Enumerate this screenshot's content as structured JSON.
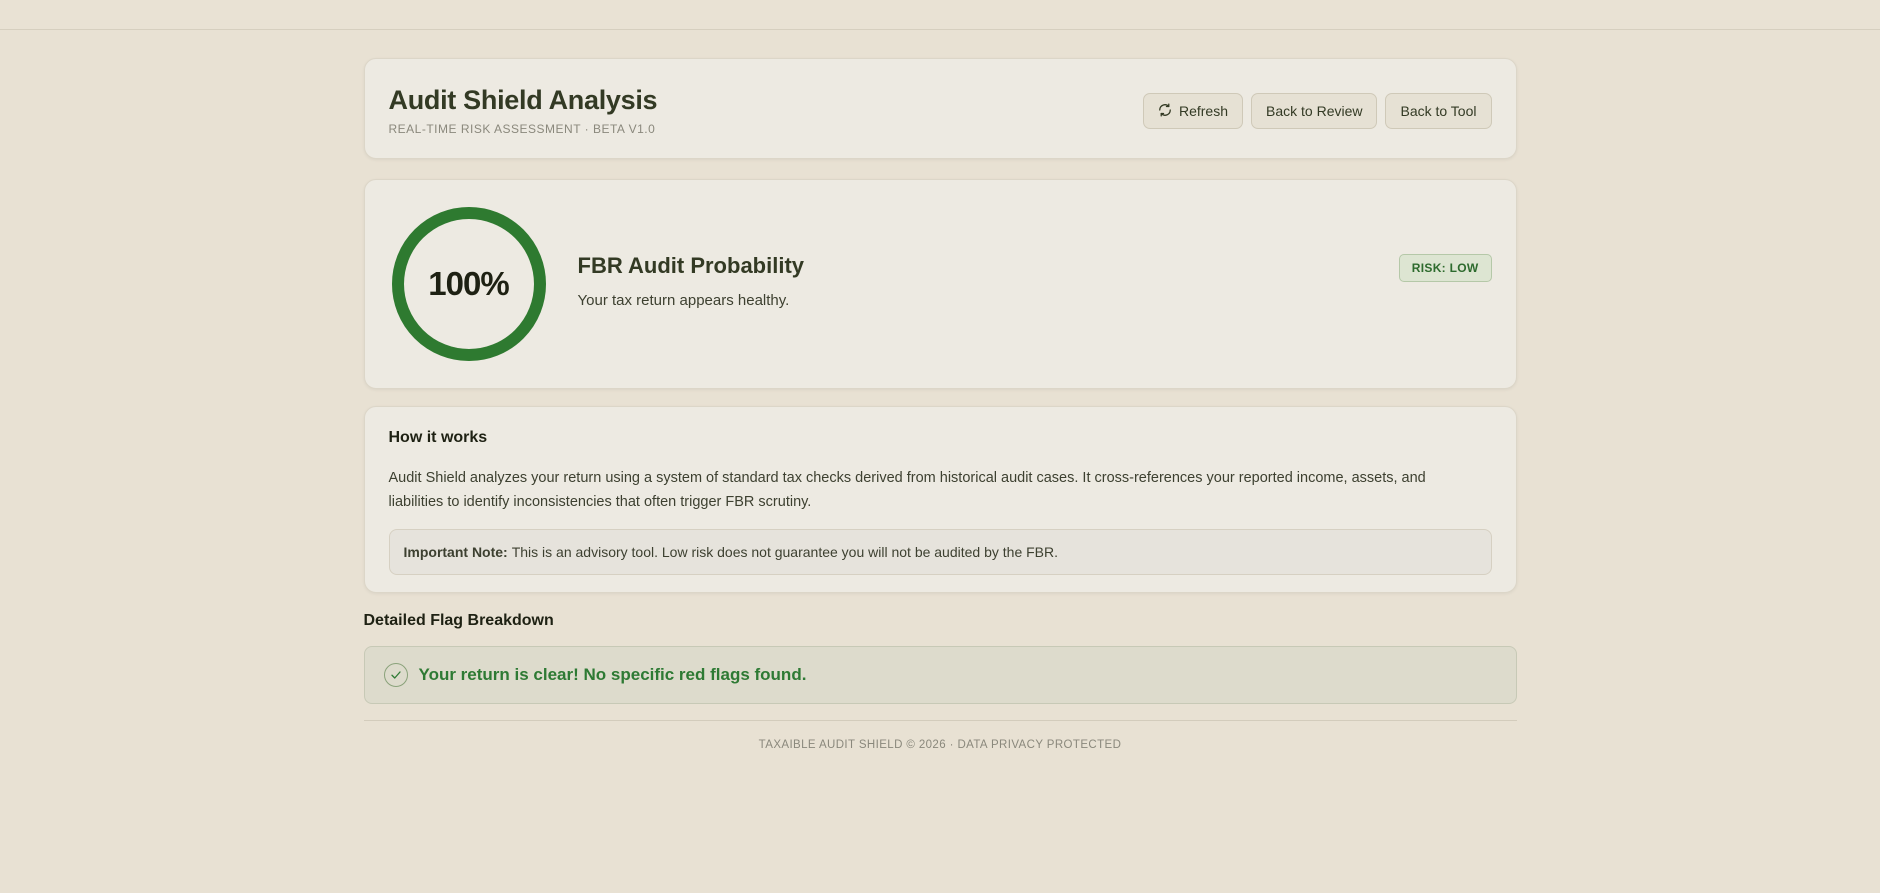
{
  "header": {
    "title": "Audit Shield Analysis",
    "subtitle": "REAL-TIME RISK ASSESSMENT · BETA V1.0",
    "buttons": {
      "refresh": "Refresh",
      "back_to_review": "Back to Review",
      "back_to_tool": "Back to Tool"
    }
  },
  "score": {
    "value": 100,
    "value_label": "100%",
    "title": "FBR Audit Probability",
    "description": "Your tax return appears healthy.",
    "risk_badge": "RISK: LOW",
    "gauge_color": "#2e7a30",
    "gauge_track_color": "#d6d8c4"
  },
  "how_it_works": {
    "title": "How it works",
    "body": "Audit Shield analyzes your return using a system of standard tax checks derived from historical audit cases. It cross-references your reported income, assets, and liabilities to identify inconsistencies that often trigger FBR scrutiny.",
    "note_label": "Important Note:",
    "note_text": "This is an advisory tool. Low risk does not guarantee you will not be audited by the FBR."
  },
  "breakdown": {
    "title": "Detailed Flag Breakdown",
    "clear_message": "Your return is clear! No specific red flags found.",
    "icon": "check-circle-icon"
  },
  "footer": {
    "text": "TAXAIBLE AUDIT SHIELD © 2026 · DATA PRIVACY PROTECTED"
  },
  "colors": {
    "accent_green": "#2e7a34",
    "background": "#e8e1d3",
    "card": "#edeae2"
  }
}
